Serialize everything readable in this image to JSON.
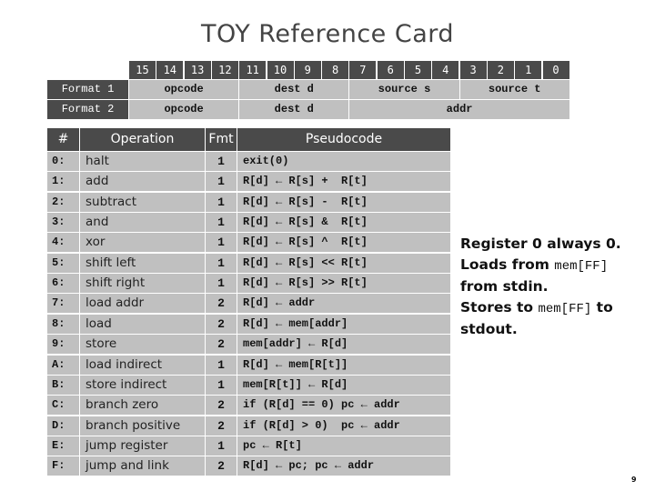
{
  "title": "TOY Reference Card",
  "format_table": {
    "bits": [
      "15",
      "14",
      "13",
      "12",
      "11",
      "10",
      "9",
      "8",
      "7",
      "6",
      "5",
      "4",
      "3",
      "2",
      "1",
      "0"
    ],
    "formats": [
      {
        "label": "Format 1",
        "fields": [
          {
            "name": "opcode",
            "bits": 4
          },
          {
            "name": "dest d",
            "bits": 4
          },
          {
            "name": "source s",
            "bits": 4
          },
          {
            "name": "source t",
            "bits": 4
          }
        ]
      },
      {
        "label": "Format 2",
        "fields": [
          {
            "name": "opcode",
            "bits": 4
          },
          {
            "name": "dest d",
            "bits": 4
          },
          {
            "name": "addr",
            "bits": 8
          }
        ]
      }
    ]
  },
  "ops_table": {
    "headers": {
      "num": "#",
      "operation": "Operation",
      "fmt": "Fmt",
      "pseudocode": "Pseudocode"
    },
    "rows": [
      {
        "num": "0:",
        "operation": "halt",
        "fmt": "1",
        "pseudocode": "exit(0)"
      },
      {
        "num": "1:",
        "operation": "add",
        "fmt": "1",
        "pseudocode": "R[d] ← R[s] +  R[t]"
      },
      {
        "num": "2:",
        "operation": "subtract",
        "fmt": "1",
        "pseudocode": "R[d] ← R[s] -  R[t]"
      },
      {
        "num": "3:",
        "operation": "and",
        "fmt": "1",
        "pseudocode": "R[d] ← R[s] &  R[t]"
      },
      {
        "num": "4:",
        "operation": "xor",
        "fmt": "1",
        "pseudocode": "R[d] ← R[s] ^  R[t]"
      },
      {
        "num": "5:",
        "operation": "shift left",
        "fmt": "1",
        "pseudocode": "R[d] ← R[s] << R[t]"
      },
      {
        "num": "6:",
        "operation": "shift right",
        "fmt": "1",
        "pseudocode": "R[d] ← R[s] >> R[t]"
      },
      {
        "num": "7:",
        "operation": "load addr",
        "fmt": "2",
        "pseudocode": "R[d] ← addr"
      },
      {
        "num": "8:",
        "operation": "load",
        "fmt": "2",
        "pseudocode": "R[d] ← mem[addr]"
      },
      {
        "num": "9:",
        "operation": "store",
        "fmt": "2",
        "pseudocode": "mem[addr] ← R[d]"
      },
      {
        "num": "A:",
        "operation": "load indirect",
        "fmt": "1",
        "pseudocode": "R[d] ← mem[R[t]]"
      },
      {
        "num": "B:",
        "operation": "store indirect",
        "fmt": "1",
        "pseudocode": "mem[R[t]] ← R[d]"
      },
      {
        "num": "C:",
        "operation": "branch zero",
        "fmt": "2",
        "pseudocode": "if (R[d] == 0) pc ← addr"
      },
      {
        "num": "D:",
        "operation": "branch positive",
        "fmt": "2",
        "pseudocode": "if (R[d] > 0)  pc ← addr"
      },
      {
        "num": "E:",
        "operation": "jump register",
        "fmt": "1",
        "pseudocode": "pc ← R[t]"
      },
      {
        "num": "F:",
        "operation": "jump and link",
        "fmt": "2",
        "pseudocode": "R[d] ← pc; pc ← addr"
      }
    ]
  },
  "notes": {
    "line1": "Register 0 always 0.",
    "line2_text": "Loads from ",
    "line2_code": "mem[FF]",
    "line3": "from stdin.",
    "line4_text": "Stores to ",
    "line4_code": "mem[FF]",
    "line4_tail": " to",
    "line5": "stdout."
  },
  "page_number": "9"
}
